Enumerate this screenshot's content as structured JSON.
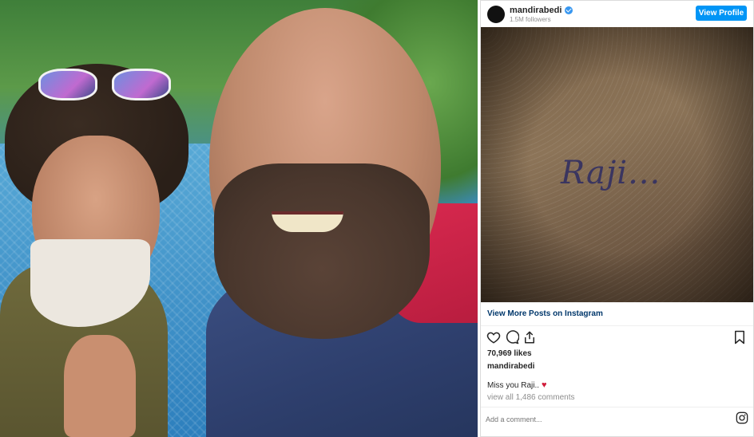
{
  "embed": {
    "username": "mandirabedi",
    "followers": "1.5M followers",
    "view_profile_label": "View Profile",
    "post_image_text": "Raji...",
    "more_posts_label": "View More Posts on Instagram",
    "likes": "70,969 likes",
    "caption_user": "mandirabedi",
    "caption_text": "Miss you Raji..",
    "comments_link": "view all 1,486 comments",
    "comment_placeholder": "Add a comment...",
    "icons": {
      "like": "heart-outline-icon",
      "comment": "speech-bubble-icon",
      "share": "share-upload-icon",
      "save": "bookmark-icon",
      "verified": "verified-badge-icon",
      "brand": "instagram-icon"
    },
    "colors": {
      "button": "#0095f6",
      "link": "#00376b",
      "heart": "#d11d3b"
    }
  }
}
